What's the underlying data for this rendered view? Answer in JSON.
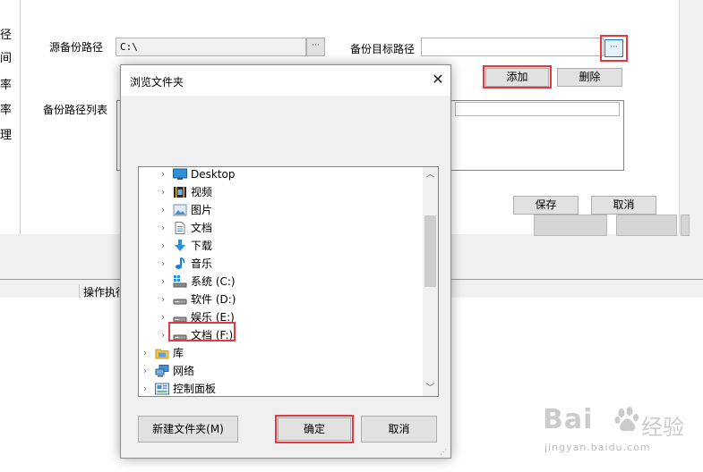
{
  "parent_window": {
    "side_labels": [
      "径",
      "间",
      "率",
      "率",
      "理"
    ],
    "source_label": "源备份路径",
    "source_value": "C:\\",
    "ellipsis": "···",
    "target_label": "备份目标路径",
    "target_value": "",
    "add_label": "添加",
    "delete_label": "删除",
    "list_label": "备份路径列表",
    "save_label": "保存",
    "cancel_label": "取消",
    "bottom_column": "操作执行"
  },
  "dialog": {
    "title": "浏览文件夹",
    "close_glyph": "✕",
    "tree": [
      {
        "label": "Desktop",
        "icon": "desktop-icon",
        "level": 1
      },
      {
        "label": "视频",
        "icon": "video-icon",
        "level": 1
      },
      {
        "label": "图片",
        "icon": "pictures-icon",
        "level": 1
      },
      {
        "label": "文档",
        "icon": "document-icon",
        "level": 1
      },
      {
        "label": "下载",
        "icon": "download-icon",
        "level": 1
      },
      {
        "label": "音乐",
        "icon": "music-icon",
        "level": 1
      },
      {
        "label": "系统 (C:)",
        "icon": "system-drive-icon",
        "level": 1
      },
      {
        "label": "软件 (D:)",
        "icon": "drive-icon",
        "level": 1
      },
      {
        "label": "娱乐 (E:)",
        "icon": "drive-icon",
        "level": 1
      },
      {
        "label": "文档 (F:)",
        "icon": "drive-icon",
        "level": 1,
        "selected": true
      },
      {
        "label": "库",
        "icon": "library-icon",
        "level": 0
      },
      {
        "label": "网络",
        "icon": "network-icon",
        "level": 0
      },
      {
        "label": "控制面板",
        "icon": "control-panel-icon",
        "level": 0
      }
    ],
    "new_folder_label": "新建文件夹(M)",
    "ok_label": "确定",
    "cancel_label": "取消"
  },
  "watermark": {
    "brand": "Bai",
    "brand2": "经验",
    "url": "jingyan.baidu.com"
  }
}
